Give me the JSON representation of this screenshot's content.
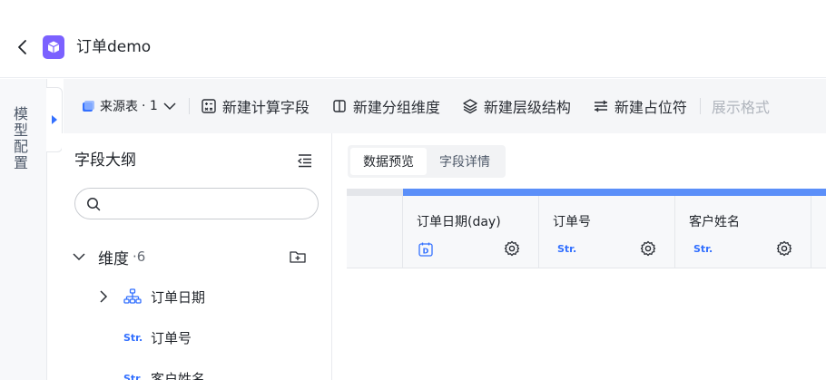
{
  "header": {
    "title": "订单demo"
  },
  "rail": {
    "label": "模型配置"
  },
  "toolbar": {
    "source_label": "来源表",
    "source_count": "· 1",
    "buttons": [
      {
        "label": "新建计算字段",
        "icon": "calc-field-icon"
      },
      {
        "label": "新建分组维度",
        "icon": "group-dimension-icon"
      },
      {
        "label": "新建层级结构",
        "icon": "layers-icon"
      },
      {
        "label": "新建占位符",
        "icon": "placeholder-icon"
      }
    ],
    "display_format_label": "展示格式"
  },
  "outline": {
    "title": "字段大纲",
    "search_placeholder": "",
    "dimension_group": {
      "label": "维度",
      "count": "·6"
    },
    "items": [
      {
        "type": "hierarchy",
        "label": "订单日期"
      },
      {
        "type": "Str.",
        "label": "订单号"
      },
      {
        "type": "Str.",
        "label": "客户姓名"
      }
    ]
  },
  "content": {
    "tabs": [
      {
        "label": "数据预览",
        "active": true
      },
      {
        "label": "字段详情",
        "active": false
      }
    ],
    "columns": [
      {
        "name": "订单日期(day)",
        "type": "date"
      },
      {
        "name": "订单号",
        "type": "Str."
      },
      {
        "name": "客户姓名",
        "type": "Str."
      }
    ]
  },
  "colors": {
    "accent": "#3370ff",
    "logo": "#7b61ff",
    "column_bar": "#5b8ff9"
  }
}
